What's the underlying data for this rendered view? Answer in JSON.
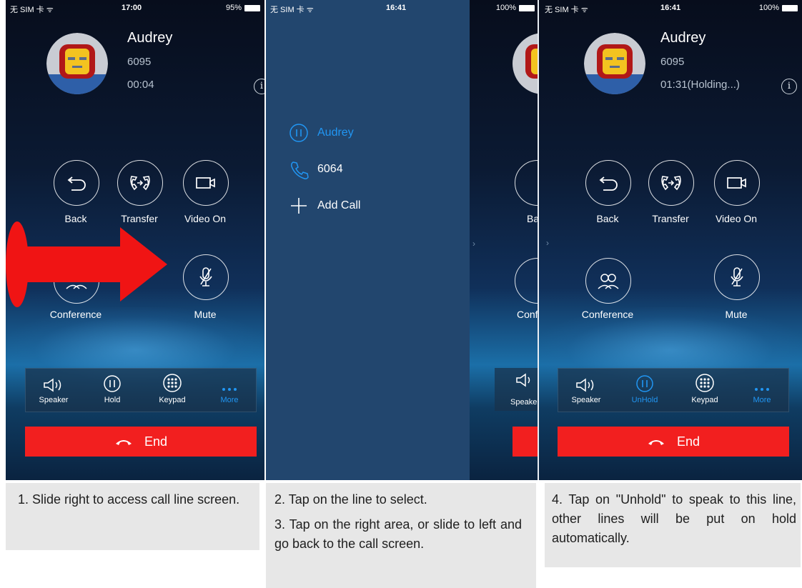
{
  "screen1": {
    "status": {
      "carrier": "无 SIM 卡 ᯤ",
      "time": "17:00",
      "battery": "95%"
    },
    "contact": {
      "name": "Audrey",
      "number": "6095",
      "time": "00:04"
    },
    "controls": [
      {
        "label": "Back",
        "icon": "back-arrow-icon"
      },
      {
        "label": "Transfer",
        "icon": "transfer-icon"
      },
      {
        "label": "Video On",
        "icon": "video-camera-icon"
      },
      {
        "label": "Conference",
        "icon": "conference-icon"
      },
      {
        "label": "Mute",
        "icon": "mic-off-icon"
      }
    ],
    "tray": [
      {
        "label": "Speaker"
      },
      {
        "label": "Hold"
      },
      {
        "label": "Keypad"
      },
      {
        "label": "More"
      }
    ],
    "end_label": "End"
  },
  "screen2": {
    "status": {
      "carrier": "无 SIM 卡 ᯤ",
      "time": "16:41",
      "battery": "100%"
    },
    "lines": [
      {
        "label": "Audrey",
        "icon": "pause-circle-icon",
        "color": "#2196f3"
      },
      {
        "label": "6064",
        "icon": "phone-icon"
      },
      {
        "label": "Add Call",
        "icon": "plus-icon"
      }
    ],
    "peek": {
      "back": "Ba",
      "conference": "Conf",
      "speaker": "Speaker"
    }
  },
  "screen3": {
    "status": {
      "carrier": "无 SIM 卡 ᯤ",
      "time": "16:41",
      "battery": "100%"
    },
    "contact": {
      "name": "Audrey",
      "number": "6095",
      "time": "01:31(Holding...)"
    },
    "controls": [
      {
        "label": "Back"
      },
      {
        "label": "Transfer"
      },
      {
        "label": "Video On"
      },
      {
        "label": "Conference"
      },
      {
        "label": "Mute"
      }
    ],
    "tray": [
      {
        "label": "Speaker"
      },
      {
        "label": "UnHold"
      },
      {
        "label": "Keypad"
      },
      {
        "label": "More"
      }
    ],
    "end_label": "End"
  },
  "captions": {
    "c1": "1. Slide right to access call line screen.",
    "c2a": "2. Tap on the line to select.",
    "c2b": "3. Tap on the right area, or slide to left and go back to the call screen.",
    "c3": "4. Tap on \"Unhold\" to speak to this line, other lines will be put on hold automatically."
  },
  "colors": {
    "accent": "#2196f3",
    "end": "#f21f1f",
    "arrow": "#f01414",
    "drawer": "#22466e"
  }
}
